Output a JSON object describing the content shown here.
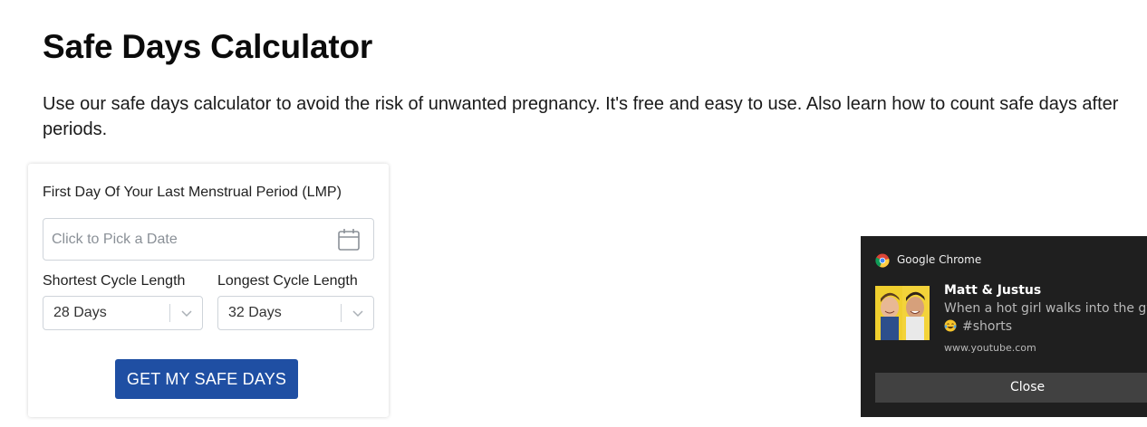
{
  "page": {
    "title": "Safe Days Calculator",
    "intro": "Use our safe days calculator to avoid the risk of unwanted pregnancy. It's free and easy to use. Also learn how to count safe days after periods."
  },
  "calculator": {
    "lmp_label": "First Day Of Your Last Menstrual Period (LMP)",
    "date_placeholder": "Click to Pick a Date",
    "date_icon": "calendar-icon",
    "shortest_label": "Shortest Cycle Length",
    "shortest_value": "28 Days",
    "longest_label": "Longest Cycle Length",
    "longest_value": "32 Days",
    "submit_label": "GET MY SAFE DAYS",
    "accent_color": "#1f4fa3"
  },
  "notification": {
    "app_name": "Google Chrome",
    "app_icon": "chrome-icon",
    "title": "Matt & Justus",
    "message": "When a hot girl walks into the gym",
    "message_emoji": "tears-of-joy-emoji",
    "message_line2": "#shorts",
    "source": "www.youtube.com",
    "close_label": "Close",
    "background_color": "#1f1f1f"
  }
}
